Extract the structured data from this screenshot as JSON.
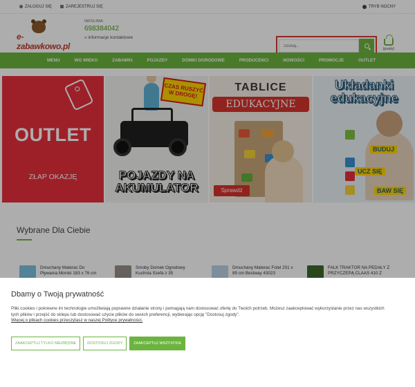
{
  "topbar": {
    "login": "ZALOGUJ SIĘ",
    "register": "ZAREJESTRUJ SIĘ",
    "night_mode": "TRYB NOCNY"
  },
  "header": {
    "logo_text": "e-zabawkowo.pl",
    "infoline_label": "INFOLINIA",
    "phone": "698384042",
    "contact_link": "» informacje kontaktowe",
    "search_placeholder": "Szukaj...",
    "cart_label": "(pusty)"
  },
  "nav": {
    "items": [
      "MENU",
      "WG WIEKU",
      "ZABAWKI",
      "POJAZDY",
      "DOMKI OGRODOWE",
      "PRODUCENCI",
      "NOWOŚCI",
      "PROMOCJE",
      "OUTLET"
    ]
  },
  "banners": {
    "outlet_big": "OUTLET",
    "outlet_small": "ZŁAP OKAZJĘ",
    "vehicles_sticker": "CZAS RUSZYĆ W DROGĘ!",
    "vehicles_title": "POJAZDY NA AKUMULATOR",
    "boards_title": "TABLICE",
    "boards_ribbon": "EDUKACYJNE",
    "boards_cta": "Sprawdź",
    "puzzles_title": "Układanki edukacyjne",
    "puzzles_l1": "BUDUJ",
    "puzzles_l2": "UCZ SIĘ",
    "puzzles_l3": "BAW SIĘ"
  },
  "section": {
    "title": "Wybrane Dla Ciebie"
  },
  "products": [
    {
      "name": "Dmuchany Materac Do Pływania Morski 183 x 76 cm",
      "color": "#7cc0e0"
    },
    {
      "name": "Smoby Domek Ogrodowy Kuchnia Szefa z 35",
      "color": "#9a8f86"
    },
    {
      "name": "Dmuchany Materac Fotel 201 x 89 cm Bestway 43023",
      "color": "#b9d2e6"
    },
    {
      "name": "FALK TRAKTOR NA PEDAŁY Z PRZYCZEPĄ CLAAS 410 Z",
      "color": "#3c6b2a"
    }
  ],
  "cookie": {
    "title": "Dbamy o Twoją prywatność",
    "body": "Pliki cookies i pokrewne im technologie umożliwiają poprawne działanie strony i pomagają nam dostosować ofertę do Twoich potrzeb. Możesz zaakceptować wykorzystanie przez nas wszystkich tych plików i przejść do sklepu lub dostosować użycie plików do swoich preferencji, wybierając opcję \"Dostosuj zgody\".",
    "more": "Więcej o plikach cookies przeczytasz w naszej Polityce prywatności.",
    "btn_necessary": "ZAAKCEPTUJ TYLKO NIEZBĘDNE",
    "btn_customize": "DOSTOSUJ ZGODY",
    "btn_accept_all": "ZAAKCEPTUJ WSZYSTKIE"
  },
  "colors": {
    "brand_green": "#6cb43f",
    "search_highlight": "#d23b32"
  }
}
